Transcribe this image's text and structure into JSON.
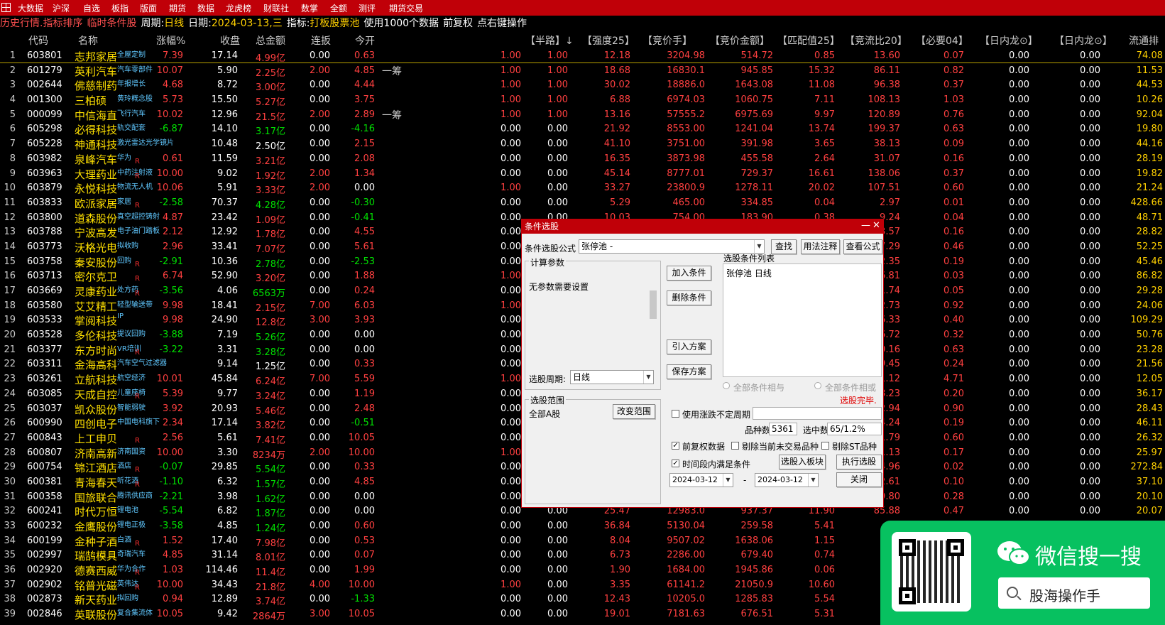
{
  "menubar": [
    "大数据",
    "沪深",
    "自选",
    "板指",
    "版面",
    "期货",
    "数据",
    "龙虎榜",
    "财联社",
    "数掌",
    "全额",
    "测评",
    "期货交易"
  ],
  "infobar": {
    "history": "历史行情.指标排序",
    "condition": "临时条件股",
    "period_label": "周期:",
    "period_value": "日线",
    "date_label": "日期:",
    "date_value": "2024-03-13,三",
    "indicator_label": "指标:",
    "indicator_value": "打板股票池",
    "data_note": "使用1000个数据",
    "adj": "前复权",
    "hint": "点右键操作"
  },
  "headers": [
    "代码",
    "名称",
    "涨幅%",
    "收盘",
    "总金额",
    "连扳",
    "今开",
    "【半路】↓",
    "【强度25】",
    "【竞价手】",
    "【竞价金额】",
    "【匹配值25】",
    "【竞流比20】",
    "【必要04】",
    "【日内龙⊙】",
    "【日内龙⊙】",
    "流通排"
  ],
  "rows": [
    [
      "1",
      "603801",
      "志邦家居",
      "全屋定制",
      "",
      "7.39",
      "17.14",
      "4.99亿",
      "0.00",
      "0.63",
      "",
      "1.00",
      "1.00",
      "12.18",
      "3204.98",
      "514.72",
      "0.85",
      "13.60",
      "0.07",
      "0.00",
      "0.00",
      "74.08"
    ],
    [
      "2",
      "601279",
      "英利汽车",
      "汽车零部件",
      "",
      "10.07",
      "5.90",
      "2.25亿",
      "2.00",
      "4.85",
      "一筹",
      "1.00",
      "1.00",
      "18.68",
      "16830.1",
      "945.85",
      "15.32",
      "86.11",
      "0.82",
      "0.00",
      "0.00",
      "11.53"
    ],
    [
      "3",
      "002644",
      "佛慈制药",
      "年报增长",
      "",
      "4.68",
      "8.72",
      "3.00亿",
      "0.00",
      "4.44",
      "",
      "1.00",
      "1.00",
      "30.02",
      "18886.0",
      "1643.08",
      "11.08",
      "96.38",
      "0.37",
      "0.00",
      "0.00",
      "44.53"
    ],
    [
      "4",
      "001300",
      "三柏硕",
      "黄玲概念股",
      "",
      "5.73",
      "15.50",
      "5.27亿",
      "0.00",
      "3.75",
      "",
      "1.00",
      "1.00",
      "6.88",
      "6974.03",
      "1060.75",
      "7.11",
      "108.13",
      "1.03",
      "0.00",
      "0.00",
      "10.26"
    ],
    [
      "5",
      "000099",
      "中信海直",
      "飞行汽车",
      "",
      "10.02",
      "12.96",
      "21.5亿",
      "2.00",
      "2.89",
      "一筹",
      "1.00",
      "1.00",
      "13.16",
      "57555.2",
      "6975.69",
      "9.97",
      "120.89",
      "0.76",
      "0.00",
      "0.00",
      "92.04"
    ],
    [
      "6",
      "605298",
      "必得科技",
      "轨交配套",
      "",
      "-6.87",
      "14.10",
      "3.17亿",
      "0.00",
      "-4.16",
      "",
      "0.00",
      "0.00",
      "21.92",
      "8553.00",
      "1241.04",
      "13.74",
      "199.37",
      "0.63",
      "0.00",
      "0.00",
      "19.80"
    ],
    [
      "7",
      "605228",
      "神通科技",
      "激光雷达光学镜片",
      "",
      "",
      "10.48",
      "2.50亿",
      "0.00",
      "2.15",
      "",
      "0.00",
      "0.00",
      "41.10",
      "3751.00",
      "391.98",
      "3.65",
      "38.13",
      "0.09",
      "0.00",
      "0.00",
      "44.16"
    ],
    [
      "8",
      "603982",
      "泉峰汽车",
      "华为",
      "R",
      "0.61",
      "11.59",
      "3.21亿",
      "0.00",
      "2.08",
      "",
      "0.00",
      "0.00",
      "16.35",
      "3873.98",
      "455.58",
      "2.64",
      "31.07",
      "0.16",
      "0.00",
      "0.00",
      "28.19"
    ],
    [
      "9",
      "603963",
      "大理药业",
      "中药注射液",
      "R",
      "10.00",
      "9.02",
      "1.92亿",
      "2.00",
      "1.34",
      "",
      "0.00",
      "0.00",
      "45.14",
      "8777.01",
      "729.37",
      "16.61",
      "138.06",
      "0.37",
      "0.00",
      "0.00",
      "19.82"
    ],
    [
      "10",
      "603879",
      "永悦科技",
      "物流无人机",
      "",
      "10.06",
      "5.91",
      "3.33亿",
      "2.00",
      "0.00",
      "",
      "1.00",
      "0.00",
      "33.27",
      "23800.9",
      "1278.11",
      "20.02",
      "107.51",
      "0.60",
      "0.00",
      "0.00",
      "21.24"
    ],
    [
      "11",
      "603833",
      "欧派家居",
      "家居",
      "R",
      "-2.58",
      "70.37",
      "4.28亿",
      "0.00",
      "-0.30",
      "",
      "0.00",
      "0.00",
      "5.29",
      "465.00",
      "334.85",
      "0.04",
      "2.97",
      "0.01",
      "0.00",
      "0.00",
      "428.66"
    ],
    [
      "12",
      "603800",
      "道森股份",
      "真空超控铸射",
      "",
      "4.87",
      "23.42",
      "1.09亿",
      "0.00",
      "-0.41",
      "",
      "0.00",
      "0.00",
      "10.03",
      "754.00",
      "183.90",
      "0.38",
      "9.24",
      "0.04",
      "0.00",
      "0.00",
      "48.71"
    ],
    [
      "13",
      "603788",
      "宁波高发",
      "电子油门踏板",
      "",
      "2.12",
      "12.92",
      "1.78亿",
      "0.00",
      "4.55",
      "",
      "0.00",
      "0.00",
      "",
      "",
      "",
      "",
      "3.57",
      "0.16",
      "0.00",
      "0.00",
      "28.82"
    ],
    [
      "14",
      "603773",
      "沃格光电",
      "拟收购",
      "",
      "2.96",
      "33.41",
      "7.07亿",
      "0.00",
      "5.61",
      "",
      "0.00",
      "0.00",
      "",
      "",
      "",
      "",
      "57.29",
      "0.46",
      "0.00",
      "0.00",
      "52.25"
    ],
    [
      "15",
      "603758",
      "秦安股份",
      "回购",
      "R",
      "-2.91",
      "10.36",
      "2.78亿",
      "0.00",
      "-2.53",
      "",
      "0.00",
      "0.00",
      "",
      "",
      "",
      "",
      "52.35",
      "0.19",
      "0.00",
      "0.00",
      "45.46"
    ],
    [
      "16",
      "603713",
      "密尔克卫",
      "",
      "R",
      "6.74",
      "52.90",
      "3.20亿",
      "0.00",
      "1.88",
      "",
      "1.00",
      "0.00",
      "",
      "",
      "",
      "",
      "6.81",
      "0.03",
      "0.00",
      "0.00",
      "86.82"
    ],
    [
      "17",
      "603669",
      "灵康药业",
      "处方药",
      "R",
      "-3.56",
      "4.06",
      "6563万",
      "0.00",
      "0.24",
      "",
      "0.00",
      "0.00",
      "",
      "",
      "",
      "",
      "1.74",
      "0.05",
      "0.00",
      "0.00",
      "29.28"
    ],
    [
      "18",
      "603580",
      "艾艾精工",
      "轻型输送带",
      "",
      "9.98",
      "18.41",
      "2.15亿",
      "7.00",
      "6.03",
      "",
      "1.00",
      "0.00",
      "",
      "",
      "",
      "",
      "32.73",
      "0.92",
      "0.00",
      "0.00",
      "24.06"
    ],
    [
      "19",
      "603533",
      "掌阅科技",
      "IP",
      "",
      "9.98",
      "24.90",
      "12.8亿",
      "3.00",
      "3.93",
      "",
      "0.00",
      "0.00",
      "",
      "",
      "",
      "",
      "36.33",
      "0.40",
      "0.00",
      "0.00",
      "109.29"
    ],
    [
      "20",
      "603528",
      "多伦科技",
      "提议回购",
      "",
      "-3.88",
      "7.19",
      "5.26亿",
      "0.00",
      "0.00",
      "",
      "0.00",
      "0.00",
      "",
      "",
      "",
      "",
      "6.72",
      "0.32",
      "0.00",
      "0.00",
      "50.76"
    ],
    [
      "21",
      "603377",
      "东方时尚",
      "VR培训",
      "R",
      "-3.22",
      "3.31",
      "3.28亿",
      "0.00",
      "0.00",
      "",
      "0.00",
      "0.00",
      "",
      "",
      "",
      "",
      "0.16",
      "0.63",
      "0.00",
      "0.00",
      "23.28"
    ],
    [
      "22",
      "603311",
      "金海高科",
      "汽车空气过滤器",
      "",
      "",
      "9.14",
      "1.25亿",
      "0.00",
      "0.33",
      "",
      "0.00",
      "0.00",
      "",
      "",
      "",
      "",
      "9.45",
      "0.24",
      "0.00",
      "0.00",
      "21.56"
    ],
    [
      "23",
      "603261",
      "立航科技",
      "航空经济",
      "",
      "10.01",
      "45.84",
      "6.24亿",
      "7.00",
      "5.59",
      "",
      "1.00",
      "0.00",
      "",
      "",
      "",
      "",
      "1.12",
      "4.71",
      "0.00",
      "0.00",
      "12.05"
    ],
    [
      "24",
      "603085",
      "天成自控",
      "儿童座椅",
      "R",
      "5.39",
      "9.77",
      "3.24亿",
      "0.00",
      "1.19",
      "",
      "0.00",
      "0.00",
      "",
      "",
      "",
      "",
      "8.23",
      "0.20",
      "0.00",
      "0.00",
      "36.17"
    ],
    [
      "25",
      "603037",
      "凯众股份",
      "智能弱驶",
      "",
      "3.92",
      "20.93",
      "5.46亿",
      "0.00",
      "2.48",
      "",
      "0.00",
      "0.00",
      "",
      "",
      "",
      "",
      "2.94",
      "0.90",
      "0.00",
      "0.00",
      "28.43"
    ],
    [
      "26",
      "600990",
      "四创电子",
      "中国电科旗下",
      "",
      "2.34",
      "17.14",
      "3.82亿",
      "0.00",
      "-0.51",
      "",
      "0.00",
      "0.00",
      "",
      "",
      "",
      "",
      "4.24",
      "0.19",
      "0.00",
      "0.00",
      "46.11"
    ],
    [
      "27",
      "600843",
      "上工申贝",
      "",
      "R",
      "2.56",
      "5.61",
      "7.41亿",
      "0.00",
      "10.05",
      "",
      "0.00",
      "0.00",
      "",
      "",
      "",
      "",
      "1.79",
      "0.60",
      "0.00",
      "0.00",
      "26.32"
    ],
    [
      "28",
      "600807",
      "济南高新",
      "济南国资",
      "",
      "10.00",
      "3.30",
      "8234万",
      "2.00",
      "10.00",
      "",
      "1.00",
      "0.00",
      "",
      "",
      "",
      "",
      "1.13",
      "0.17",
      "0.00",
      "0.00",
      "25.97"
    ],
    [
      "29",
      "600754",
      "锦江酒店",
      "酒店",
      "R",
      "-0.07",
      "29.85",
      "5.54亿",
      "0.00",
      "0.33",
      "",
      "0.00",
      "0.00",
      "",
      "",
      "",
      "",
      "4.96",
      "0.02",
      "0.00",
      "0.00",
      "272.84"
    ],
    [
      "30",
      "600381",
      "青海春天",
      "听花酒",
      "R",
      "-1.10",
      "6.32",
      "1.57亿",
      "0.00",
      "4.85",
      "",
      "0.00",
      "0.00",
      "",
      "",
      "",
      "",
      "2.61",
      "0.10",
      "0.00",
      "0.00",
      "37.10"
    ],
    [
      "31",
      "600358",
      "国旅联合",
      "腾讯供应商",
      "",
      "-2.21",
      "3.98",
      "1.62亿",
      "0.00",
      "0.00",
      "",
      "0.00",
      "0.00",
      "",
      "",
      "",
      "",
      "9.80",
      "0.28",
      "0.00",
      "0.00",
      "20.10"
    ],
    [
      "32",
      "600241",
      "时代万恒",
      "锂电池",
      "",
      "-5.54",
      "6.82",
      "1.87亿",
      "0.00",
      "0.00",
      "",
      "0.00",
      "0.00",
      "25.47",
      "12983.0",
      "937.37",
      "11.90",
      "85.88",
      "0.47",
      "0.00",
      "0.00",
      "20.07"
    ],
    [
      "33",
      "600232",
      "金鹰股份",
      "锂电正极",
      "",
      "-3.58",
      "4.85",
      "1.24亿",
      "0.00",
      "0.60",
      "",
      "0.00",
      "0.00",
      "36.84",
      "5130.04",
      "259.58",
      "5.41",
      "",
      "",
      "0.00",
      "0.00",
      ""
    ],
    [
      "34",
      "600199",
      "金种子酒",
      "白酒",
      "R",
      "1.52",
      "17.40",
      "7.98亿",
      "0.00",
      "0.53",
      "",
      "0.00",
      "0.00",
      "8.04",
      "9507.02",
      "1638.06",
      "1.15",
      "",
      "",
      "",
      "",
      ""
    ],
    [
      "35",
      "002997",
      "瑞鹄模具",
      "奇瑞汽车",
      "",
      "4.85",
      "31.14",
      "8.01亿",
      "0.00",
      "0.07",
      "",
      "0.00",
      "0.00",
      "6.73",
      "2286.00",
      "679.40",
      "0.74",
      "",
      "",
      "",
      "",
      ""
    ],
    [
      "36",
      "002920",
      "德赛西威",
      "华为合作",
      "R",
      "1.03",
      "114.46",
      "11.4亿",
      "0.00",
      "1.99",
      "",
      "0.00",
      "0.00",
      "1.90",
      "1684.00",
      "1945.86",
      "0.06",
      "",
      "",
      "",
      "",
      ""
    ],
    [
      "37",
      "002902",
      "铭普光磁",
      "英伟达",
      "R",
      "10.00",
      "34.43",
      "21.8亿",
      "4.00",
      "10.00",
      "",
      "1.00",
      "0.00",
      "3.35",
      "61141.2",
      "21050.9",
      "10.60",
      "",
      "",
      "",
      "",
      ""
    ],
    [
      "38",
      "002873",
      "新天药业",
      "拟回购",
      "",
      "0.94",
      "12.89",
      "3.74亿",
      "0.00",
      "-1.33",
      "",
      "0.00",
      "0.00",
      "12.43",
      "10205.0",
      "1285.83",
      "5.54",
      "",
      "",
      "",
      "",
      ""
    ],
    [
      "39",
      "002846",
      "英联股份",
      "复合集流体",
      "",
      "10.05",
      "9.42",
      "2864万",
      "3.00",
      "10.05",
      "",
      "0.00",
      "0.00",
      "19.01",
      "7181.63",
      "676.51",
      "5.31",
      "",
      "",
      "",
      "",
      ""
    ]
  ],
  "dialog": {
    "title": "条件选股",
    "formula_label": "条件选股公式",
    "formula_value": "张停池 -",
    "btn_find": "查找",
    "btn_usage": "用法注释",
    "btn_view": "查看公式",
    "params_label": "计算参数",
    "params_text": "无参数需要设置",
    "cond_list_label": "选股条件列表",
    "cond_list_item": "张停池 日线",
    "btn_add": "加入条件",
    "btn_del": "删除条件",
    "btn_import": "引入方案",
    "btn_save": "保存方案",
    "period_label": "选股周期:",
    "period_value": "日线",
    "radio_and": "全部条件相与",
    "radio_or": "全部条件相或",
    "status": "选股完毕.",
    "range_label": "选股范围",
    "range_value": "全部A股",
    "btn_range": "改变范围",
    "chk_irregular": "使用涨跌不定周期",
    "count_label": "品种数",
    "count_value": "5361",
    "selected_label": "选中数",
    "selected_value": "65/1.2%",
    "chk_adj": "前复权数据",
    "chk_exclude_today": "剔除当前未交易品种",
    "chk_exclude_st": "剔除ST品种",
    "chk_time": "时间段内满足条件",
    "btn_to_block": "选股入板块",
    "btn_run": "执行选股",
    "date_from": "2024-03-12",
    "date_sep": "-",
    "date_to": "2024-03-12",
    "btn_close": "关闭"
  },
  "promo": {
    "title": "微信搜一搜",
    "search_text": "股海操作手"
  },
  "colors": {
    "menubar": "#c00008",
    "up": "#ff4040",
    "down": "#00e000",
    "name": "#ffe000",
    "tag": "#60c8ff",
    "promo": "#07c160"
  }
}
